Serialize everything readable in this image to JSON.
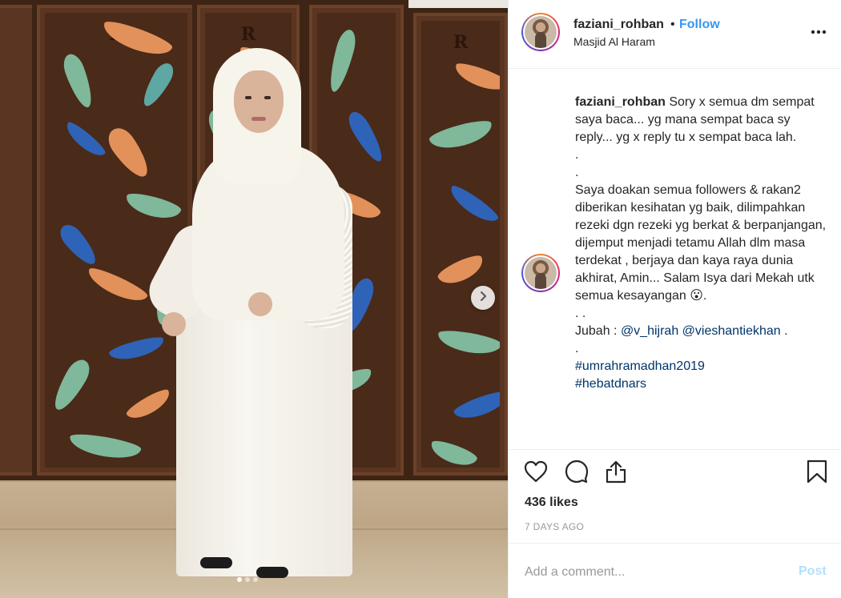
{
  "post": {
    "username": "faziani_rohban",
    "separator": "•",
    "follow_label": "Follow",
    "location": "Masjid Al Haram",
    "caption_user": "faziani_rohban",
    "caption_line1": " Sory x semua dm sempat saya baca... yg mana sempat baca sy reply... yg x reply tu x sempat baca lah.\n.\n.\nSaya doakan semua followers & rakan2 diberikan kesihatan yg baik, dilimpahkan rezeki dgn rezeki yg berkat & berpanjangan, dijemput menjadi tetamu Allah dlm masa terdekat , berjaya dan kaya raya dunia akhirat, Amin... Salam Isya dari Mekah utk semua kesayangan 😮.\n. .\nJubah : ",
    "mention1": "@v_hijrah",
    "mention_sep": " ",
    "mention2": "@vieshantiekhan",
    "caption_line2": " .\n.\n",
    "hashtag1": "#umrahramadhan2019",
    "hashtag2": "#hebatdnars",
    "likes": "436 likes",
    "time_ago": "7 DAYS AGO"
  },
  "comment": {
    "placeholder": "Add a comment...",
    "post_label": "Post"
  },
  "icons": {
    "like": "heart-icon",
    "comment": "comment-bubble-icon",
    "share": "share-upload-icon",
    "save": "bookmark-icon",
    "more": "more-options-icon",
    "next": "chevron-right-icon"
  },
  "carousel": {
    "count": 3,
    "active_index": 0
  },
  "colors": {
    "link": "#003569",
    "follow": "#3897f0",
    "post_disabled": "#b2dffc",
    "muted": "#999999"
  }
}
